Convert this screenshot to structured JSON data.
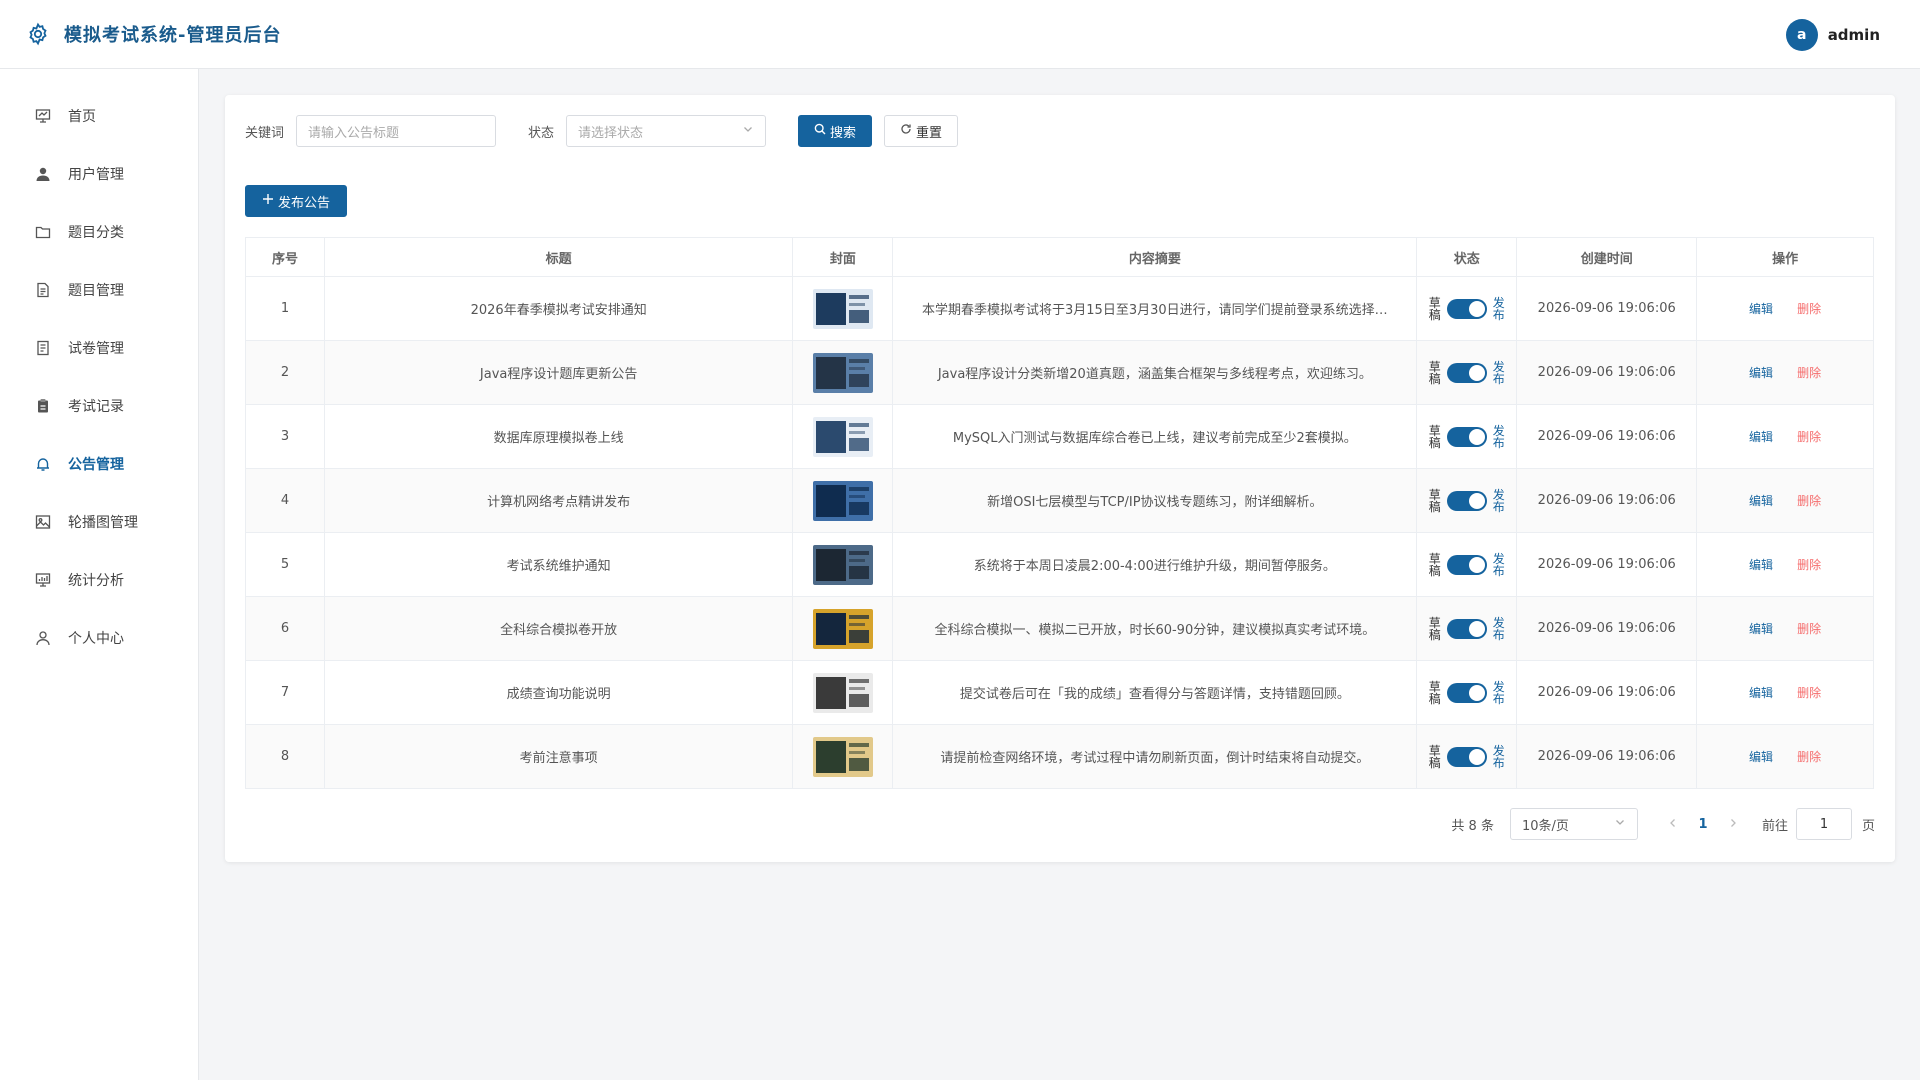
{
  "header": {
    "title": "模拟考试系统-管理员后台",
    "avatar_letter": "a",
    "username": "admin"
  },
  "sidebar": {
    "items": [
      {
        "label": "首页",
        "icon": "dashboard-icon"
      },
      {
        "label": "用户管理",
        "icon": "user-icon"
      },
      {
        "label": "题目分类",
        "icon": "folder-icon"
      },
      {
        "label": "题目管理",
        "icon": "document-icon"
      },
      {
        "label": "试卷管理",
        "icon": "paper-icon"
      },
      {
        "label": "考试记录",
        "icon": "clipboard-icon"
      },
      {
        "label": "公告管理",
        "icon": "bell-icon",
        "active": true
      },
      {
        "label": "轮播图管理",
        "icon": "picture-icon"
      },
      {
        "label": "统计分析",
        "icon": "chart-icon"
      },
      {
        "label": "个人中心",
        "icon": "profile-icon"
      }
    ]
  },
  "filters": {
    "keyword_label": "关键词",
    "keyword_placeholder": "请输入公告标题",
    "status_label": "状态",
    "status_placeholder": "请选择状态",
    "search_label": "搜索",
    "reset_label": "重置"
  },
  "publish_label": "发布公告",
  "table": {
    "headers": [
      "序号",
      "标题",
      "封面",
      "内容摘要",
      "状态",
      "创建时间",
      "操作"
    ],
    "status_off": "草稿",
    "status_on": "发布",
    "edit_label": "编辑",
    "delete_label": "删除",
    "rows": [
      {
        "no": "1",
        "title": "2026年春季模拟考试安排通知",
        "summary": "本学期春季模拟考试将于3月15日至3月30日进行，请同学们提前登录系统选择…",
        "created": "2026-09-06 19:06:06",
        "published": true
      },
      {
        "no": "2",
        "title": "Java程序设计题库更新公告",
        "summary": "Java程序设计分类新增20道真题，涵盖集合框架与多线程考点，欢迎练习。",
        "created": "2026-09-06 19:06:06",
        "published": true
      },
      {
        "no": "3",
        "title": "数据库原理模拟卷上线",
        "summary": "MySQL入门测试与数据库综合卷已上线，建议考前完成至少2套模拟。",
        "created": "2026-09-06 19:06:06",
        "published": true
      },
      {
        "no": "4",
        "title": "计算机网络考点精讲发布",
        "summary": "新增OSI七层模型与TCP/IP协议栈专题练习，附详细解析。",
        "created": "2026-09-06 19:06:06",
        "published": true
      },
      {
        "no": "5",
        "title": "考试系统维护通知",
        "summary": "系统将于本周日凌晨2:00-4:00进行维护升级，期间暂停服务。",
        "created": "2026-09-06 19:06:06",
        "published": true
      },
      {
        "no": "6",
        "title": "全科综合模拟卷开放",
        "summary": "全科综合模拟一、模拟二已开放，时长60-90分钟，建议模拟真实考试环境。",
        "created": "2026-09-06 19:06:06",
        "published": true
      },
      {
        "no": "7",
        "title": "成绩查询功能说明",
        "summary": "提交试卷后可在「我的成绩」查看得分与答题详情，支持错题回顾。",
        "created": "2026-09-06 19:06:06",
        "published": true
      },
      {
        "no": "8",
        "title": "考前注意事项",
        "summary": "请提前检查网络环境，考试过程中请勿刷新页面，倒计时结束将自动提交。",
        "created": "2026-09-06 19:06:06",
        "published": true
      }
    ]
  },
  "pagination": {
    "total_text": "共 8 条",
    "page_size": "10条/页",
    "current_page": "1",
    "goto_label": "前往",
    "goto_value": "1",
    "page_suffix": "页"
  },
  "colors": {
    "primary": "#15639e",
    "danger": "#f56c6c"
  }
}
